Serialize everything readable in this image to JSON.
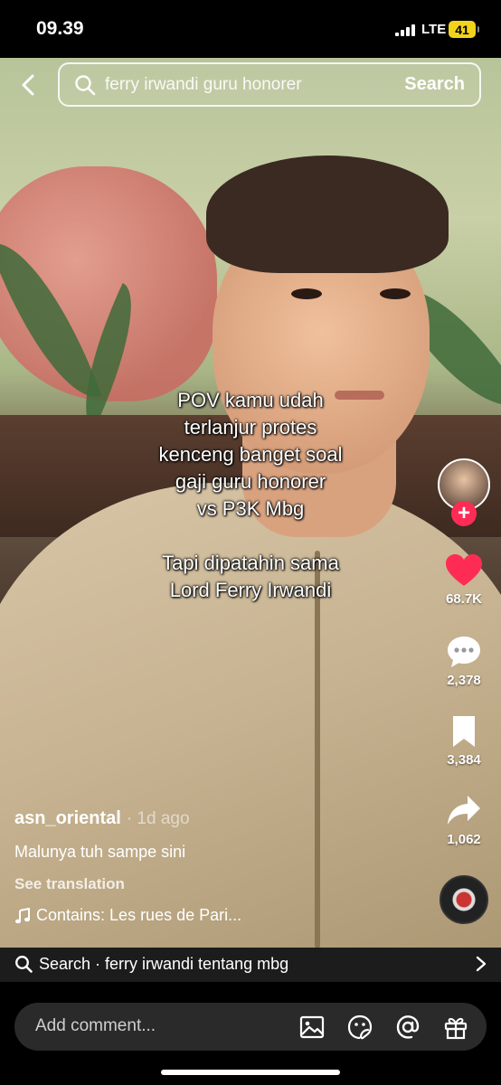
{
  "status_bar": {
    "time": "09.39",
    "network": "LTE",
    "battery": "41",
    "battery_color": "#f2d31c"
  },
  "search": {
    "query": "ferry irwandi guru honorer",
    "button_label": "Search"
  },
  "video": {
    "caption_lines": [
      "POV kamu udah",
      "terlanjur protes",
      "kenceng banget soal",
      "gaji guru honorer",
      "vs P3K Mbg"
    ],
    "caption_lines_2": [
      "Tapi dipatahin sama",
      "Lord Ferry Irwandi"
    ]
  },
  "actions": {
    "likes": "68.7K",
    "comments": "2,378",
    "saves": "3,384",
    "shares": "1,062",
    "like_color": "#fe2c55",
    "follow_symbol": "+"
  },
  "post": {
    "username": "asn_oriental",
    "time_ago": "· 1d ago",
    "description": "Malunya tuh sampe sini",
    "see_translation": "See translation",
    "music": "Contains: Les rues de Pari..."
  },
  "suggestion": {
    "text": "Search · ferry irwandi tentang mbg"
  },
  "comment_bar": {
    "placeholder": "Add comment..."
  }
}
